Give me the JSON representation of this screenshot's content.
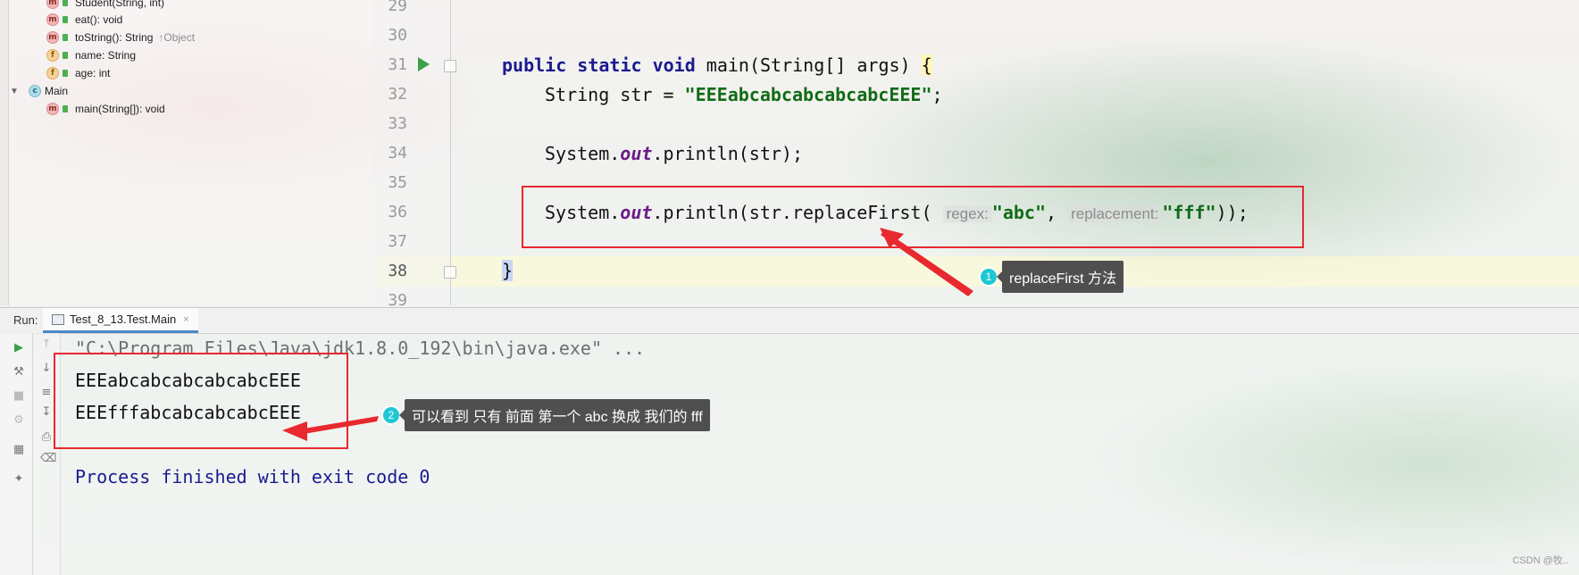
{
  "structure": {
    "items": [
      {
        "badge": "m",
        "label": "Student(String, int)",
        "hint": ""
      },
      {
        "badge": "m",
        "label": "eat(): void",
        "hint": ""
      },
      {
        "badge": "m",
        "label": "toString(): String",
        "hint": "↑Object"
      },
      {
        "badge": "f",
        "label": "name: String",
        "hint": ""
      },
      {
        "badge": "f",
        "label": "age: int",
        "hint": ""
      },
      {
        "badge": "c",
        "label": "Main",
        "hint": ""
      },
      {
        "badge": "m",
        "label": "main(String[]): void",
        "hint": ""
      }
    ]
  },
  "editor": {
    "line_numbers": [
      "29",
      "30",
      "31",
      "32",
      "33",
      "34",
      "35",
      "36",
      "37",
      "38",
      "39"
    ],
    "code": {
      "l31_kw1": "public",
      "l31_kw2": "static",
      "l31_kw3": "void",
      "l31_rest": " main(String[] args) ",
      "l31_brace": "{",
      "l32_pre": "String str = ",
      "l32_str": "\"EEEabcabcabcabcabcEEE\"",
      "l32_post": ";",
      "l34_pre": "System.",
      "l34_field": "out",
      "l34_post": ".println(str);",
      "l36_pre": "System.",
      "l36_field": "out",
      "l36_mid": ".println(str.replaceFirst(",
      "l36_hint1": "regex:",
      "l36_arg1": "\"abc\"",
      "l36_comma": ",",
      "l36_hint2": "replacement:",
      "l36_arg2": "\"fff\"",
      "l36_post": "));",
      "l38_brace": "}"
    }
  },
  "callouts": [
    {
      "num": "1",
      "text": "replaceFirst 方法"
    },
    {
      "num": "2",
      "text": "可以看到 只有 前面 第一个 abc 换成 我们的  fff"
    }
  ],
  "run": {
    "label": "Run:",
    "tab": "Test_8_13.Test.Main",
    "tab_close": "×",
    "console": {
      "cmd": "\"C:\\Program Files\\Java\\jdk1.8.0_192\\bin\\java.exe\" ...",
      "out1": "EEEabcabcabcabcabcEEE",
      "out2": "EEEfffabcabcabcabcEEE",
      "process": "Process finished with exit code 0"
    }
  },
  "watermark": "CSDN @牧.."
}
